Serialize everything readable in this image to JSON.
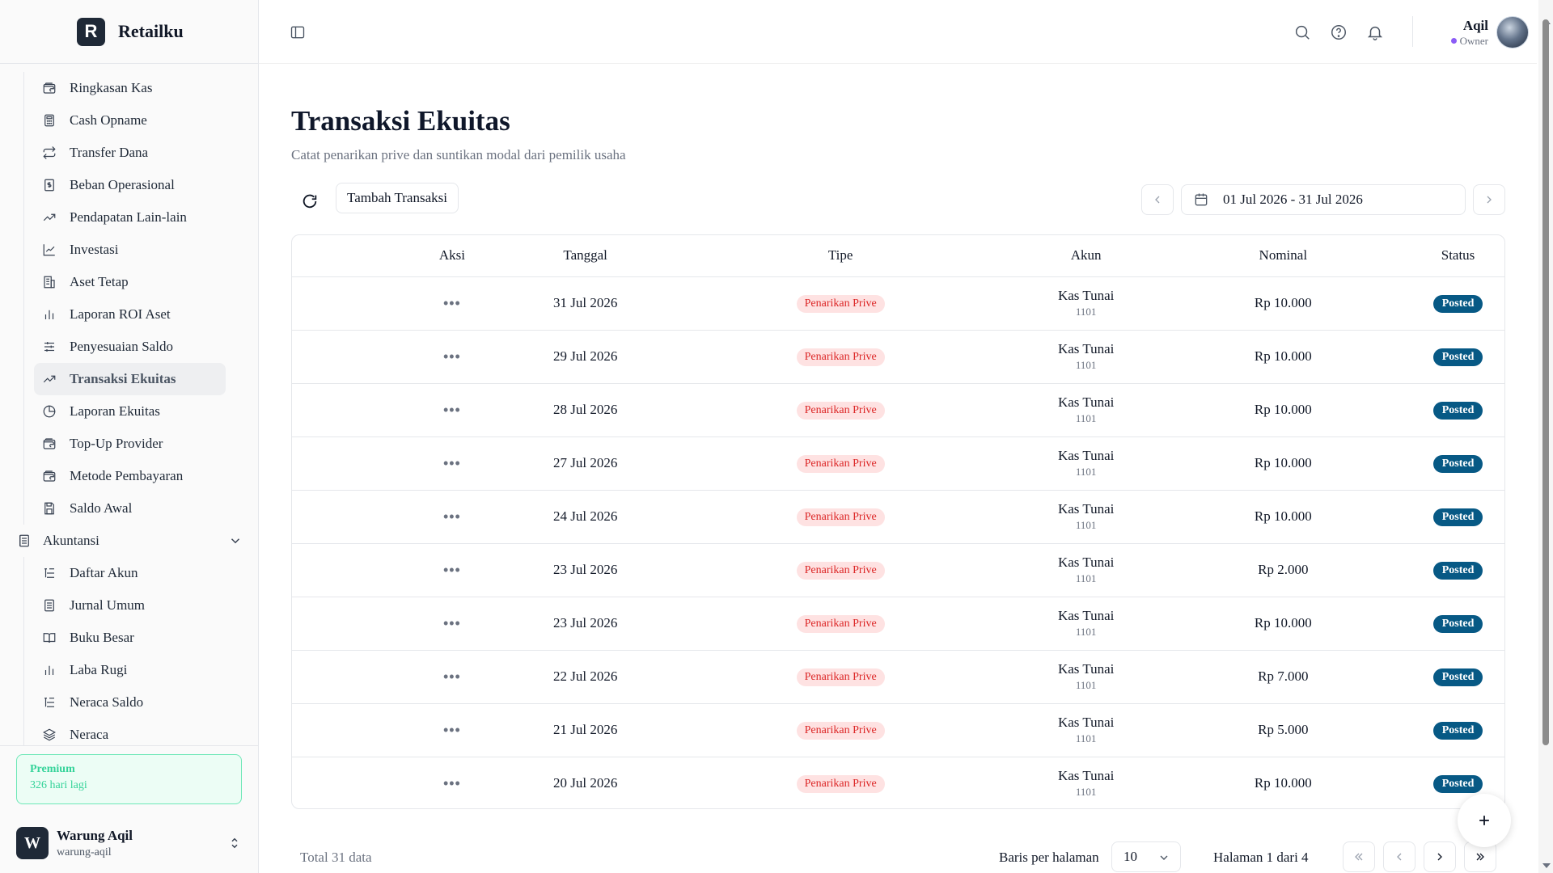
{
  "brand": {
    "logo_letter": "R",
    "name": "Retailku"
  },
  "sidebar": {
    "items": [
      {
        "label": "Ringkasan Kas",
        "icon": "wallet-icon"
      },
      {
        "label": "Cash Opname",
        "icon": "calculator-icon"
      },
      {
        "label": "Transfer Dana",
        "icon": "repeat-icon"
      },
      {
        "label": "Beban Operasional",
        "icon": "receipt-dollar-icon"
      },
      {
        "label": "Pendapatan Lain-lain",
        "icon": "trending-up-icon"
      },
      {
        "label": "Investasi",
        "icon": "line-chart-icon"
      },
      {
        "label": "Aset Tetap",
        "icon": "building-icon"
      },
      {
        "label": "Laporan ROI Aset",
        "icon": "bar-chart-icon"
      },
      {
        "label": "Penyesuaian Saldo",
        "icon": "sliders-icon"
      },
      {
        "label": "Transaksi Ekuitas",
        "icon": "trending-up-icon",
        "active": true
      },
      {
        "label": "Laporan Ekuitas",
        "icon": "pie-chart-icon"
      },
      {
        "label": "Top-Up Provider",
        "icon": "wallet-icon"
      },
      {
        "label": "Metode Pembayaran",
        "icon": "wallet-icon"
      },
      {
        "label": "Saldo Awal",
        "icon": "save-icon"
      }
    ],
    "group": {
      "label": "Akuntansi",
      "icon": "ledger-icon"
    },
    "group_items": [
      {
        "label": "Daftar Akun",
        "icon": "list-tree-icon"
      },
      {
        "label": "Jurnal Umum",
        "icon": "ledger-icon"
      },
      {
        "label": "Buku Besar",
        "icon": "book-open-icon"
      },
      {
        "label": "Laba Rugi",
        "icon": "bar-chart-icon"
      },
      {
        "label": "Neraca Saldo",
        "icon": "list-tree-icon"
      },
      {
        "label": "Neraca",
        "icon": "layers-icon"
      }
    ],
    "premium": {
      "title": "Premium",
      "remaining": "326 hari lagi"
    },
    "store": {
      "logo_letter": "W",
      "name": "Warung Aqil",
      "slug": "warung-aqil"
    }
  },
  "header": {
    "user": {
      "name": "Aqil",
      "role": "Owner"
    }
  },
  "page": {
    "title": "Transaksi Ekuitas",
    "subtitle": "Catat penarikan prive dan suntikan modal dari pemilik usaha",
    "add_button": "Tambah Transaksi",
    "date_range": "01 Jul 2026 - 31 Jul 2026"
  },
  "table": {
    "columns": [
      "Aksi",
      "Tanggal",
      "Tipe",
      "Akun",
      "Nominal",
      "Status"
    ],
    "rows": [
      {
        "tanggal": "31 Jul 2026",
        "tipe": "Penarikan Prive",
        "akun": "Kas Tunai",
        "kode": "1101",
        "nominal": "Rp 10.000",
        "status": "Posted"
      },
      {
        "tanggal": "29 Jul 2026",
        "tipe": "Penarikan Prive",
        "akun": "Kas Tunai",
        "kode": "1101",
        "nominal": "Rp 10.000",
        "status": "Posted"
      },
      {
        "tanggal": "28 Jul 2026",
        "tipe": "Penarikan Prive",
        "akun": "Kas Tunai",
        "kode": "1101",
        "nominal": "Rp 10.000",
        "status": "Posted"
      },
      {
        "tanggal": "27 Jul 2026",
        "tipe": "Penarikan Prive",
        "akun": "Kas Tunai",
        "kode": "1101",
        "nominal": "Rp 10.000",
        "status": "Posted"
      },
      {
        "tanggal": "24 Jul 2026",
        "tipe": "Penarikan Prive",
        "akun": "Kas Tunai",
        "kode": "1101",
        "nominal": "Rp 10.000",
        "status": "Posted"
      },
      {
        "tanggal": "23 Jul 2026",
        "tipe": "Penarikan Prive",
        "akun": "Kas Tunai",
        "kode": "1101",
        "nominal": "Rp 2.000",
        "status": "Posted"
      },
      {
        "tanggal": "23 Jul 2026",
        "tipe": "Penarikan Prive",
        "akun": "Kas Tunai",
        "kode": "1101",
        "nominal": "Rp 10.000",
        "status": "Posted"
      },
      {
        "tanggal": "22 Jul 2026",
        "tipe": "Penarikan Prive",
        "akun": "Kas Tunai",
        "kode": "1101",
        "nominal": "Rp 7.000",
        "status": "Posted"
      },
      {
        "tanggal": "21 Jul 2026",
        "tipe": "Penarikan Prive",
        "akun": "Kas Tunai",
        "kode": "1101",
        "nominal": "Rp 5.000",
        "status": "Posted"
      },
      {
        "tanggal": "20 Jul 2026",
        "tipe": "Penarikan Prive",
        "akun": "Kas Tunai",
        "kode": "1101",
        "nominal": "Rp 10.000",
        "status": "Posted"
      }
    ]
  },
  "pagination": {
    "total": "Total 31 data",
    "rows_label": "Baris per halaman",
    "rows_value": "10",
    "page_info": "Halaman 1 dari 4"
  },
  "colors": {
    "tipe_badge_bg": "#fee2e2",
    "tipe_badge_text": "#dc2626",
    "status_badge_bg": "#075985",
    "premium_accent": "#34d399",
    "role_dot": "#8b5cf6"
  }
}
